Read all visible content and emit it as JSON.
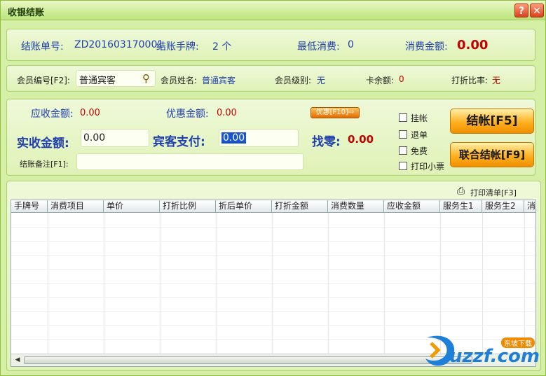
{
  "window": {
    "title": "收银结账"
  },
  "top": {
    "bill_no_label": "结账单号:",
    "bill_no": "ZD201603170001",
    "tags_label": "结账手牌:",
    "tags_value": "2 个",
    "min_label": "最低消费:",
    "min_value": "0",
    "consume_label": "消费金额:",
    "consume_value": "0.00"
  },
  "member": {
    "no_label": "会员编号[F2]:",
    "no_value": "普通宾客",
    "name_label": "会员姓名:",
    "name_value": "普通宾客",
    "level_label": "会员级别:",
    "level_value": "无",
    "balance_label": "卡余额:",
    "balance_value": "0",
    "discount_label": "打折比率:",
    "discount_value": "无"
  },
  "pay": {
    "receivable_label": "应收金额:",
    "receivable_value": "0.00",
    "discount_amt_label": "优惠金额:",
    "discount_amt_value": "0.00",
    "discount_btn": "优惠[F10]",
    "actual_label": "实收金额:",
    "actual_value": "0.00",
    "guest_label": "宾客支付:",
    "guest_value": "0.00",
    "change_label": "找零:",
    "change_value": "0.00",
    "remark_label": "结账备注[F1]:",
    "options": [
      "挂帐",
      "退单",
      "免费",
      "打印小票"
    ],
    "checkout_btn": "结帐[F5]",
    "joint_btn": "联合结帐[F9]"
  },
  "list": {
    "print_label": "打印清单[F3]",
    "columns": [
      "手牌号",
      "消费项目",
      "单价",
      "打折比例",
      "折后单价",
      "打折金额",
      "消费数量",
      "应收金额",
      "服务生1",
      "服务生2",
      "消"
    ]
  },
  "watermark": {
    "text": "uzzf.com",
    "badge": "东坡下载"
  },
  "colors": {
    "accent": "#c40000",
    "label_blue": "#1e3eae",
    "panel": "#dff2b6"
  }
}
